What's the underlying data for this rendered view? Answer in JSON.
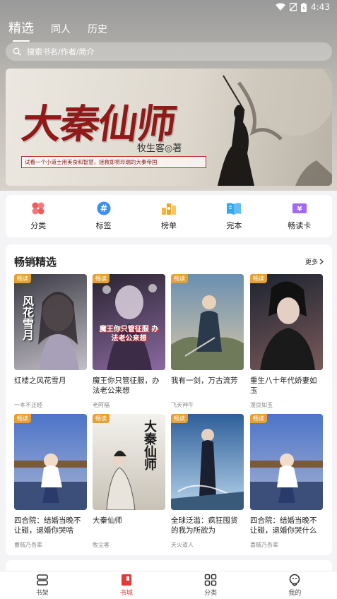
{
  "status": {
    "time": "4:43"
  },
  "tabs": [
    {
      "label": "精选"
    },
    {
      "label": "同人"
    },
    {
      "label": "历史"
    }
  ],
  "search": {
    "placeholder": "搜索书名/作者/简介"
  },
  "banner": {
    "title": "大秦仙师",
    "author": "牧生客◎著",
    "slogan": "试看一个小道士用美食和智慧，拯救即将玲瑞的大秦帝国"
  },
  "nav": [
    {
      "label": "分类",
      "icon": "clover-icon",
      "color": "#f15b5b"
    },
    {
      "label": "标签",
      "icon": "hashtag-icon",
      "color": "#3b8ef3"
    },
    {
      "label": "榜单",
      "icon": "ranking-icon",
      "color": "#f7a21b"
    },
    {
      "label": "完本",
      "icon": "open-book-icon",
      "color": "#34a8f0"
    },
    {
      "label": "畅读卡",
      "icon": "card-icon",
      "color": "#a26af3"
    }
  ],
  "section": {
    "title": "畅销精选",
    "more": "更多"
  },
  "books": [
    {
      "title": "红楼之风花雪月",
      "author": "一本不正经",
      "badge": "畅读",
      "cover_title": "风花雪月",
      "colors": [
        "#3a3a44",
        "#c4c0c8"
      ]
    },
    {
      "title": "魔王你只管征服，办法老公来想",
      "author": "老阿福",
      "badge": "畅读",
      "cover_title": "魔王你只管征服 办法老公来想",
      "colors": [
        "#2a2330",
        "#8a6aa0"
      ]
    },
    {
      "title": "我有一剑，万古流芳",
      "author": "飞天神牛",
      "badge": "畅读",
      "cover_title": "",
      "colors": [
        "#6a8fb0",
        "#d6c7a8"
      ]
    },
    {
      "title": "重生八十年代娇妻如玉",
      "author": "湿良如玉",
      "badge": "畅读",
      "cover_title": "",
      "colors": [
        "#1c2330",
        "#7a5a5a"
      ]
    },
    {
      "title": "四合院：结婚当晚不让碰，退婚你哭啥",
      "author": "曹贼乃吾辈",
      "badge": "畅读",
      "cover_title": "",
      "colors": [
        "#4d74c8",
        "#a7b3d4"
      ]
    },
    {
      "title": "大秦仙师",
      "author": "牧尘客",
      "badge": "畅读",
      "cover_title": "大秦仙师",
      "colors": [
        "#f4f2ee",
        "#c8c2b6"
      ]
    },
    {
      "title": "全球泛滥：疯狂囤货的我为所欲为",
      "author": "天火道人",
      "badge": "畅读",
      "cover_title": "",
      "colors": [
        "#2e5f9a",
        "#b8d4ea"
      ]
    },
    {
      "title": "四合院：结婚当晚不让碰，退婚你哭什么",
      "author": "喜贼乃吾辈",
      "badge": "畅读",
      "cover_title": "",
      "colors": [
        "#4d74c8",
        "#a7b3d4"
      ]
    }
  ],
  "bottom_nav": [
    {
      "label": "书架",
      "icon": "bookshelf-icon"
    },
    {
      "label": "书城",
      "icon": "bookstore-icon"
    },
    {
      "label": "分类",
      "icon": "grid-icon"
    },
    {
      "label": "我的",
      "icon": "profile-icon"
    }
  ],
  "colors": {
    "accent": "#e03c3c",
    "badge": "#e7a033"
  }
}
